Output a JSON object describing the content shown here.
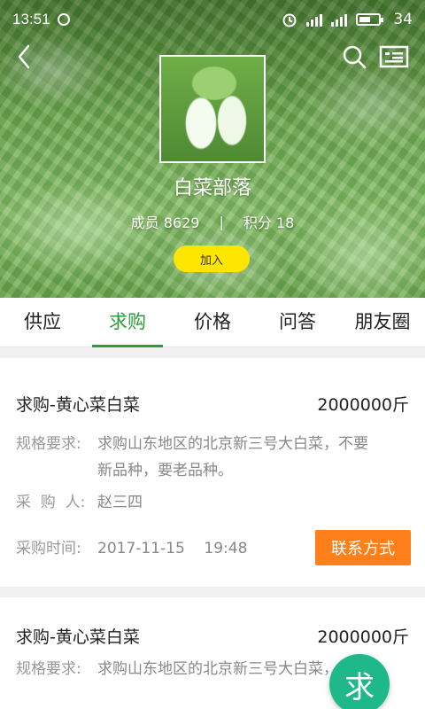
{
  "status_bar": {
    "time": "13:51",
    "battery": "34"
  },
  "group": {
    "name": "白菜部落",
    "members_label": "成员 8629",
    "separator": "|",
    "points_label": "积分 18",
    "join_label": "加入"
  },
  "tabs": [
    {
      "label": "供应",
      "active": false
    },
    {
      "label": "求购",
      "active": true
    },
    {
      "label": "价格",
      "active": false
    },
    {
      "label": "问答",
      "active": false
    },
    {
      "label": "朋友圈",
      "active": false
    }
  ],
  "posts": [
    {
      "title": "求购-黄心菜白菜",
      "quantity": "2000000斤",
      "spec_label": "规格要求:",
      "spec_line1": "求购山东地区的北京新三号大白菜，不要",
      "spec_line2": "新品种，要老品种。",
      "buyer_label": "采  购  人:",
      "buyer": "赵三四",
      "time_label": "采购时间:",
      "time": "2017-11-15    19:48",
      "contact_label": "联系方式"
    },
    {
      "title": "求购-黄心菜白菜",
      "quantity": "2000000斤",
      "spec_label": "规格要求:",
      "spec_line1": "求购山东地区的北京新三号大白菜，不要"
    }
  ],
  "fab_label": "求",
  "colors": {
    "accent_green": "#2e9c3a",
    "join_yellow": "#ffe600",
    "contact_orange": "#ff7f1a",
    "fab_teal": "#1fb88a"
  },
  "icons": [
    "back-icon",
    "search-icon",
    "profile-card-icon",
    "clock-icon",
    "alarm-icon",
    "signal-icon",
    "battery-icon"
  ]
}
